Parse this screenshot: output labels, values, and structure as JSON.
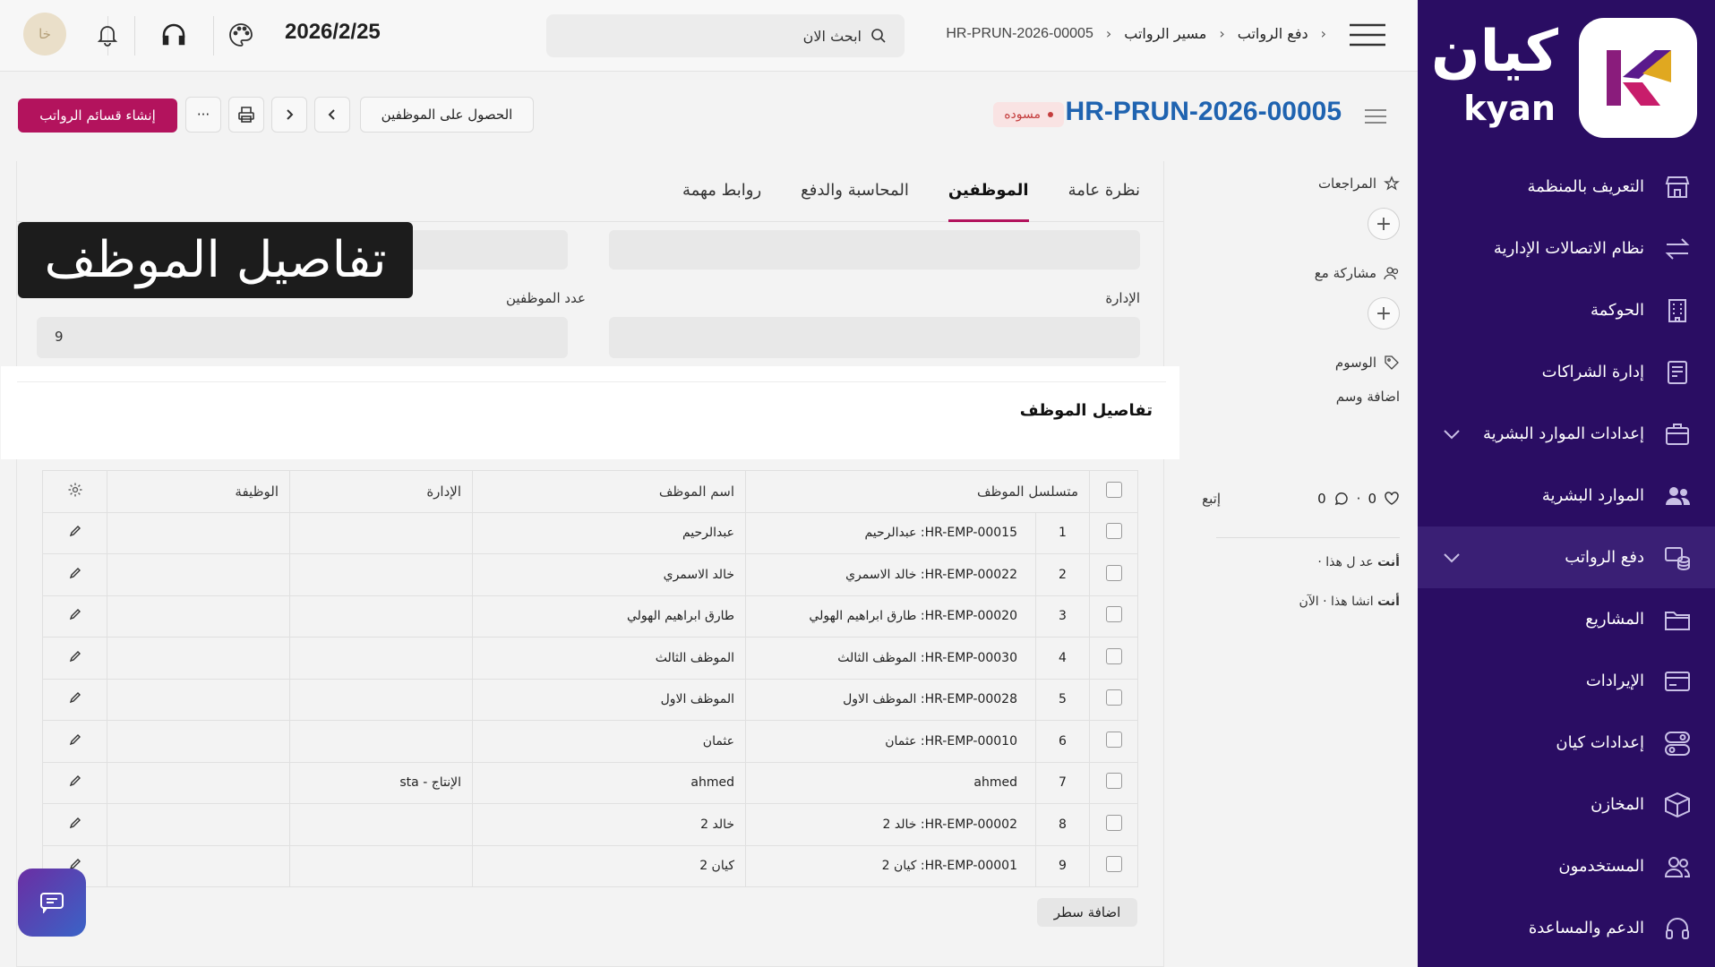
{
  "sidebar": {
    "logo_ar": "كيان",
    "logo_en": "kyan",
    "items": [
      {
        "label": "التعريف بالمنظمة",
        "icon": "store-icon"
      },
      {
        "label": "نظام الاتصالات الإدارية",
        "icon": "transfer-arrows-icon"
      },
      {
        "label": "الحوكمة",
        "icon": "building-icon"
      },
      {
        "label": "إدارة الشراكات",
        "icon": "document-icon"
      },
      {
        "label": "إعدادات الموارد البشرية",
        "icon": "briefcase-icon"
      },
      {
        "label": "الموارد البشرية",
        "icon": "users-icon"
      },
      {
        "label": "دفع الرواتب",
        "icon": "coins-icon"
      },
      {
        "label": "المشاريع",
        "icon": "folder-icon"
      },
      {
        "label": "الإيرادات",
        "icon": "card-icon"
      },
      {
        "label": "إعدادات كيان",
        "icon": "toggle-icon"
      },
      {
        "label": "المخازن",
        "icon": "box-icon"
      },
      {
        "label": "المستخدمون",
        "icon": "users-outline-icon"
      },
      {
        "label": "الدعم والمساعدة",
        "icon": "headset-icon"
      }
    ]
  },
  "topbar": {
    "breadcrumb": [
      "دفع الرواتب",
      "مسير الرواتب",
      "HR-PRUN-2026-00005"
    ],
    "search_placeholder": "ابحث الان",
    "date": "2026/2/25",
    "avatar_initials": "خا"
  },
  "header": {
    "title": "HR-PRUN-2026-00005",
    "status": "مسوده",
    "get_employees_button": "الحصول على الموظفين",
    "more_button": "···",
    "create_payslips_button": "إنشاء قسائم الرواتب"
  },
  "tabs": [
    {
      "label": "نظرة عامة",
      "active": false
    },
    {
      "label": "الموظفين",
      "active": true
    },
    {
      "label": "المحاسبة والدفع",
      "active": false
    },
    {
      "label": "روابط مهمة",
      "active": false
    }
  ],
  "form": {
    "department_label": "الإدارة",
    "employee_count_label": "عدد الموظفين",
    "employee_count_value": "9"
  },
  "side": {
    "reviews": "المراجعات",
    "shared_with": "مشاركة مع",
    "tags": "الوسوم",
    "add_tag": "اضافة وسم",
    "likes": "0",
    "comments": "0",
    "follow": "إتبع",
    "activity_1_user": "أنت",
    "activity_1_text": "عد ل هذا ·",
    "activity_2_user": "أنت",
    "activity_2_text": "انشا هذا · الآن"
  },
  "caption": "تفاصيل الموظف",
  "section_title": "تفاصيل الموظف",
  "table": {
    "headers": [
      "متسلسل الموظف",
      "اسم الموظف",
      "الإدارة",
      "الوظيفة"
    ],
    "rows": [
      {
        "n": "1",
        "serial": "HR-EMP-00015: عبدالرحيم",
        "name": "عبدالرحيم",
        "dept": "",
        "job": ""
      },
      {
        "n": "2",
        "serial": "HR-EMP-00022: خالد الاسمري",
        "name": "خالد الاسمري",
        "dept": "",
        "job": ""
      },
      {
        "n": "3",
        "serial": "HR-EMP-00020: طارق ابراهيم الهولي",
        "name": "طارق ابراهيم الهولي",
        "dept": "",
        "job": ""
      },
      {
        "n": "4",
        "serial": "HR-EMP-00030: الموظف الثالث",
        "name": "الموظف الثالث",
        "dept": "",
        "job": ""
      },
      {
        "n": "5",
        "serial": "HR-EMP-00028: الموظف الاول",
        "name": "الموظف الاول",
        "dept": "",
        "job": ""
      },
      {
        "n": "6",
        "serial": "HR-EMP-00010: عثمان",
        "name": "عثمان",
        "dept": "",
        "job": ""
      },
      {
        "n": "7",
        "serial": "ahmed",
        "name": "ahmed",
        "dept": "الإنتاج - sta",
        "job": ""
      },
      {
        "n": "8",
        "serial": "HR-EMP-00002: خالد 2",
        "name": "خالد 2",
        "dept": "",
        "job": ""
      },
      {
        "n": "9",
        "serial": "HR-EMP-00001: كيان 2",
        "name": "كيان 2",
        "dept": "",
        "job": ""
      }
    ],
    "add_row": "اضافة سطر"
  },
  "colors": {
    "sidebar_bg": "#2a0d63",
    "primary": "#b3135d",
    "title_blue": "#1f63b0",
    "draft_red": "#c43d3d"
  }
}
